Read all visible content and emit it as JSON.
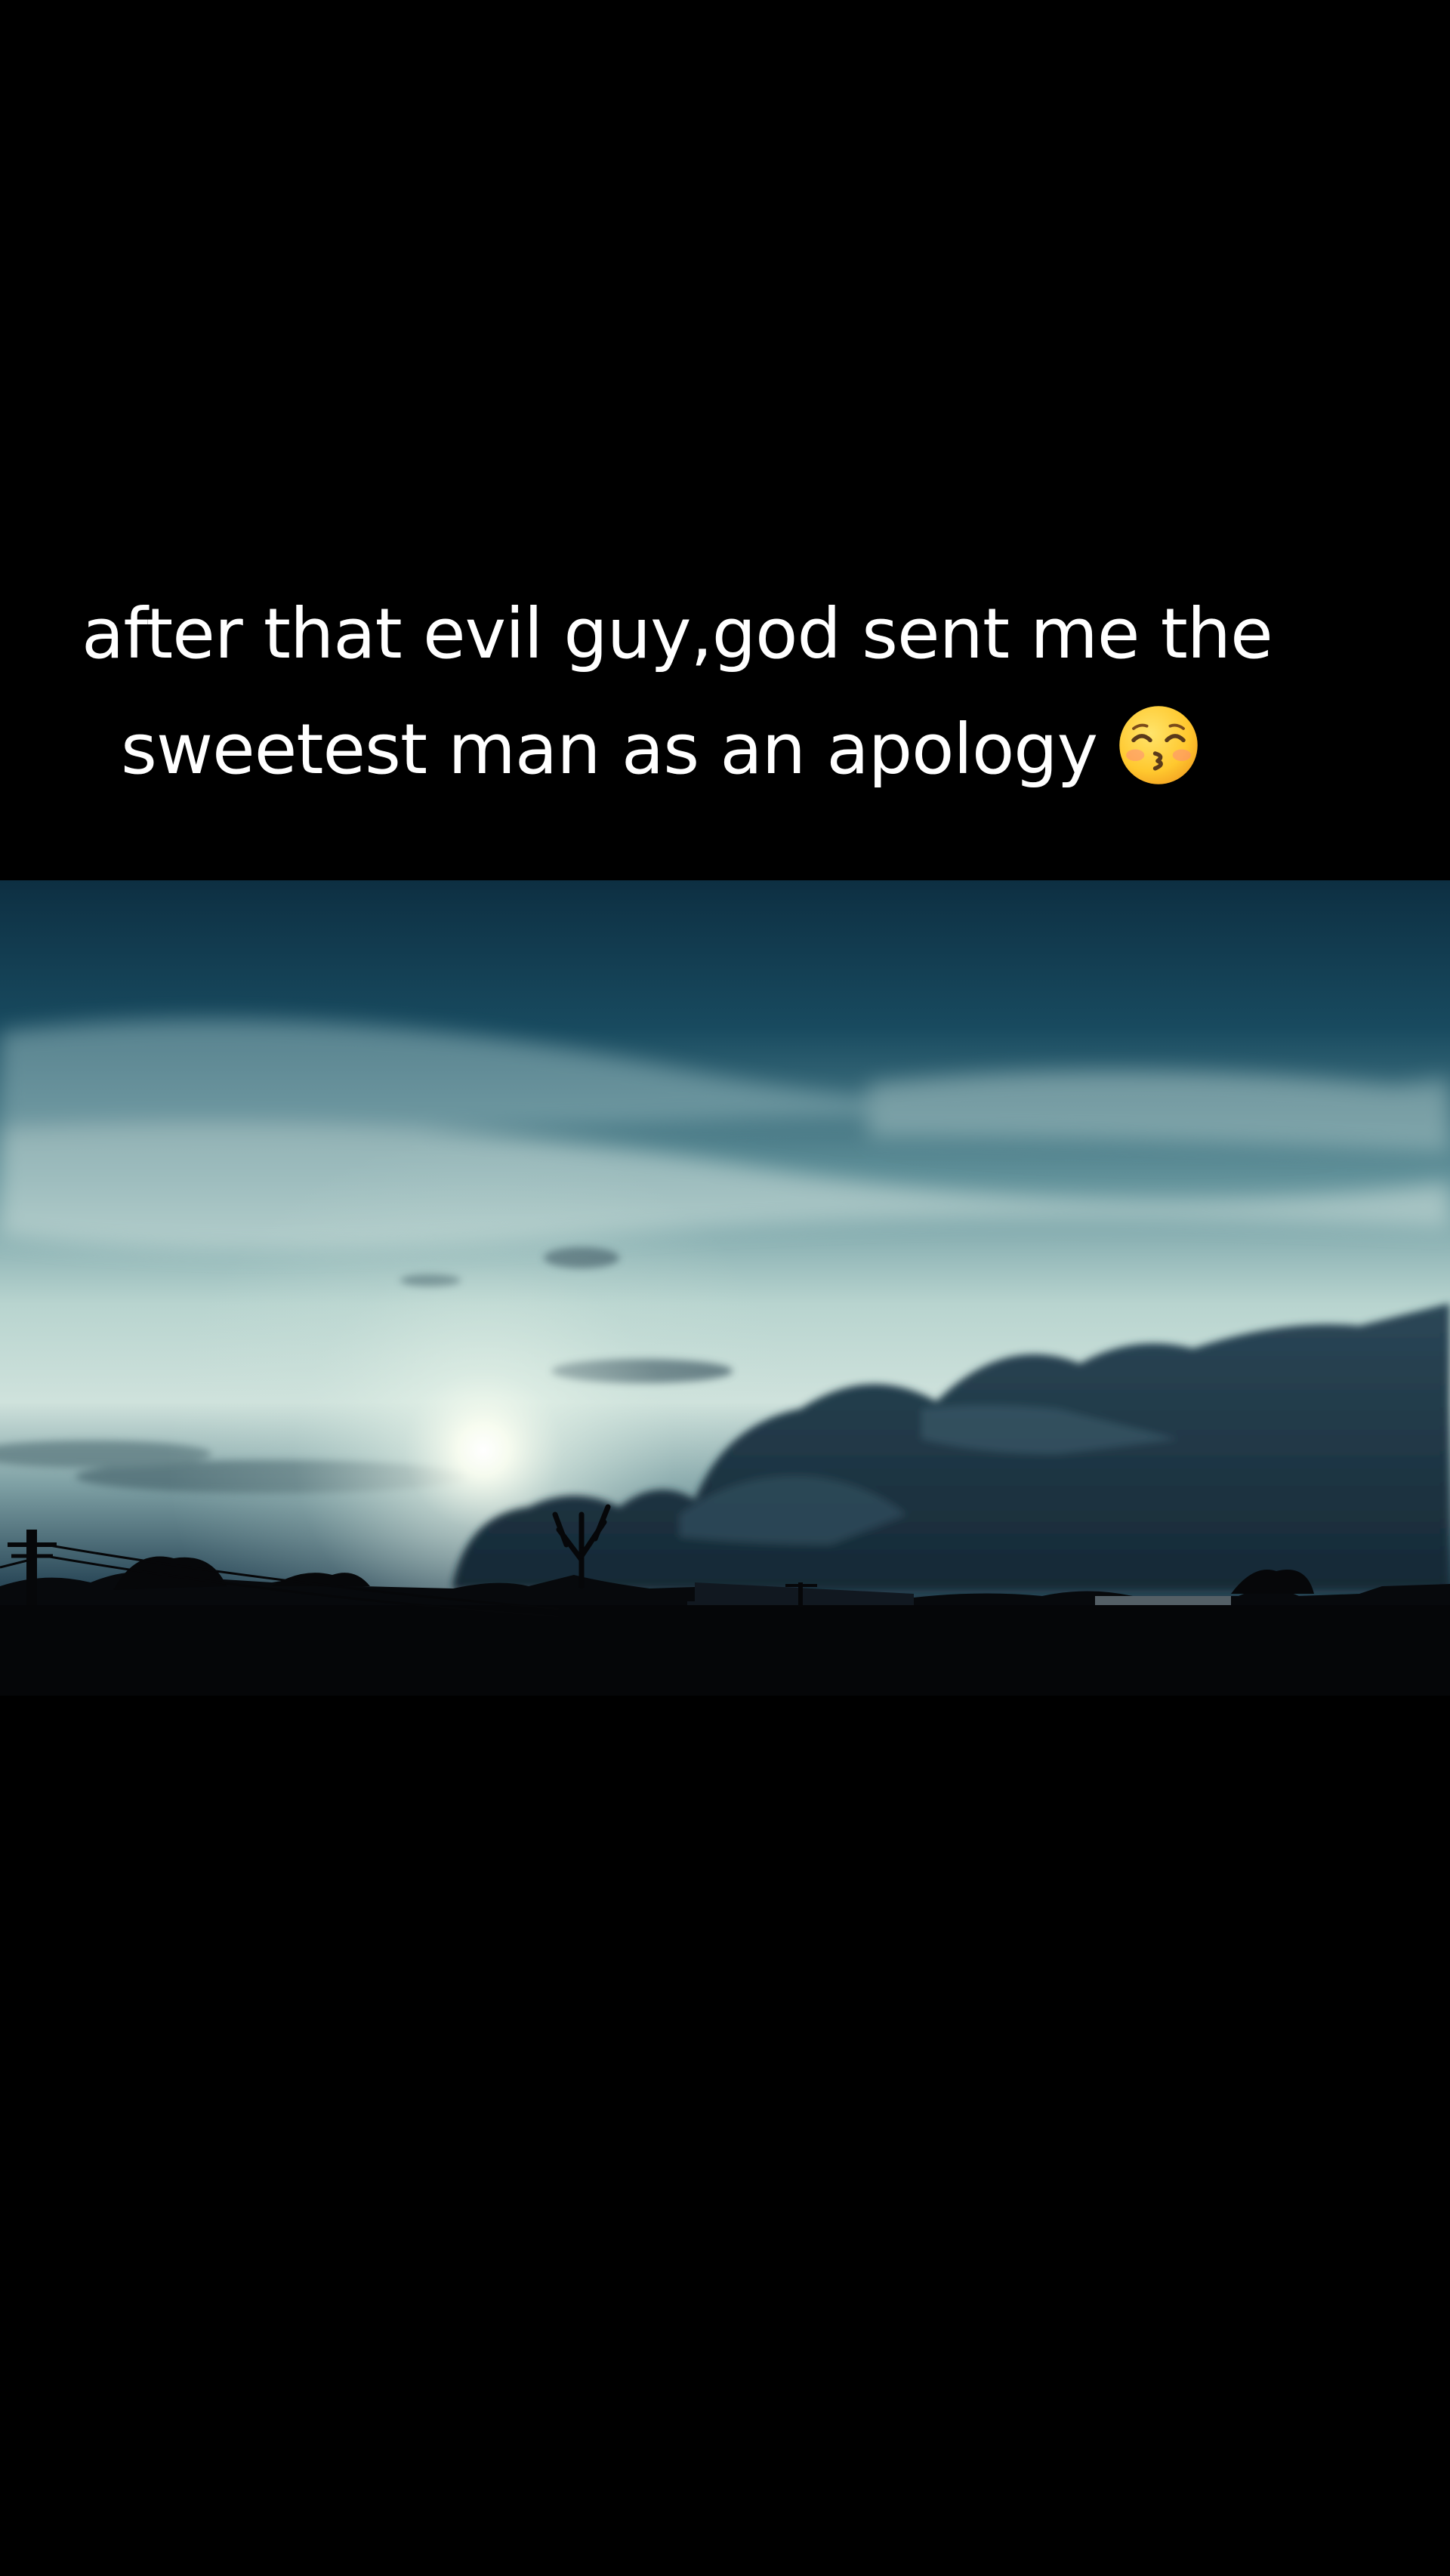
{
  "caption": {
    "line1": "after that evil guy,god sent me the",
    "line2": "sweetest man as an apology",
    "emoji": "kissing-face-with-smiling-eyes-icon"
  },
  "colors": {
    "background": "#000000",
    "caption_text": "#ffffff",
    "sky_top": "#0f3346",
    "sky_glow": "#dff0ea",
    "silhouette": "#050608"
  }
}
